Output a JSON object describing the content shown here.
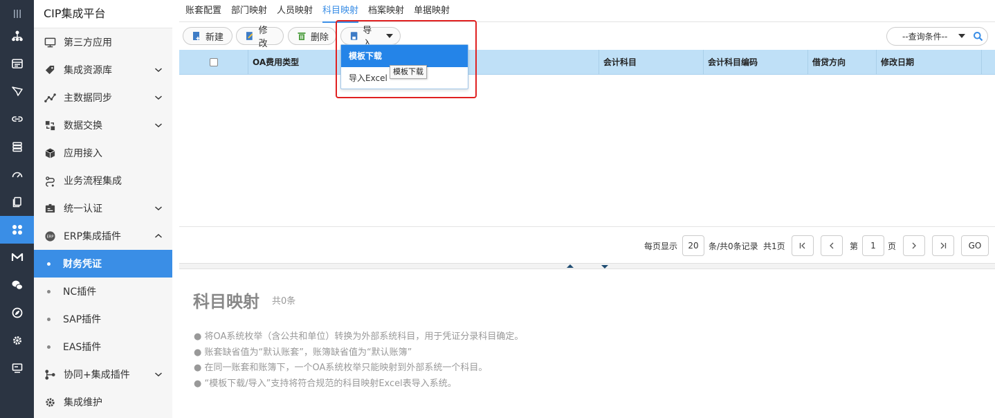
{
  "app": {
    "title": "CIP集成平台"
  },
  "rail": {
    "items": [
      {
        "icon": "menu-lines-icon"
      },
      {
        "icon": "org-tree-icon"
      },
      {
        "icon": "panel-icon"
      },
      {
        "icon": "send-icon"
      },
      {
        "icon": "link-icon"
      },
      {
        "icon": "database-icon"
      },
      {
        "icon": "gauge-icon"
      },
      {
        "icon": "copy-icon"
      },
      {
        "icon": "grid-flower-icon"
      },
      {
        "icon": "m-logo-icon"
      },
      {
        "icon": "wechat-icon"
      },
      {
        "icon": "swirl-icon"
      },
      {
        "icon": "gear-icon"
      },
      {
        "icon": "monitor-icon"
      }
    ]
  },
  "sidebar": {
    "items": [
      {
        "label": "第三方应用",
        "icon": "monitor-icon"
      },
      {
        "label": "集成资源库",
        "icon": "tag-icon"
      },
      {
        "label": "主数据同步",
        "icon": "chart-line-icon"
      },
      {
        "label": "数据交换",
        "icon": "exchange-icon"
      },
      {
        "label": "应用接入",
        "icon": "cube-icon"
      },
      {
        "label": "业务流程集成",
        "icon": "flow-icon"
      },
      {
        "label": "统一认证",
        "icon": "id-card-icon"
      },
      {
        "label": "ERP集成插件",
        "icon": "erp-icon"
      },
      {
        "label": "协同+集成插件",
        "icon": "nodes-icon"
      },
      {
        "label": "集成维护",
        "icon": "gear-icon"
      }
    ],
    "subitems": [
      {
        "label": "财务凭证"
      },
      {
        "label": "NC插件"
      },
      {
        "label": "SAP插件"
      },
      {
        "label": "EAS插件"
      }
    ]
  },
  "tabs": [
    {
      "label": "账套配置"
    },
    {
      "label": "部门映射"
    },
    {
      "label": "人员映射"
    },
    {
      "label": "科目映射"
    },
    {
      "label": "档案映射"
    },
    {
      "label": "单据映射"
    }
  ],
  "toolbar": {
    "new_label": "新建",
    "edit_label": "修改",
    "delete_label": "删除",
    "import_label": "导入"
  },
  "search": {
    "placeholder": "--查询条件--"
  },
  "table": {
    "columns": [
      "OA费用类型",
      "会计科目",
      "会计科目编码",
      "借贷方向",
      "修改日期"
    ]
  },
  "dropdown": {
    "items": [
      "模板下载",
      "导入Excel"
    ],
    "tooltip": "模板下载"
  },
  "pager": {
    "per_page_label": "每页显示",
    "per_page": "20",
    "records_text": "条/共0条记录",
    "pages_text": "共1页",
    "page_prefix": "第",
    "page": "1",
    "page_suffix": "页",
    "go_label": "GO"
  },
  "info": {
    "title": "科目映射",
    "count": "共0条",
    "lines": [
      "● 将OA系统枚举（含公共和单位）转换为外部系统科目，用于凭证分录科目确定。",
      "● 账套缺省值为“默认账套”，账簿缺省值为“默认账簿”",
      "● 在同一账套和账簿下，一个OA系统枚举只能映射到外部系统一个科目。",
      "● “模板下载/导入”支持将符合规范的科目映射Excel表导入系统。"
    ]
  },
  "colors": {
    "accent": "#3a8ee6",
    "rail": "#2b3442",
    "header": "#bfe0f7",
    "highlight": "#e02020"
  }
}
